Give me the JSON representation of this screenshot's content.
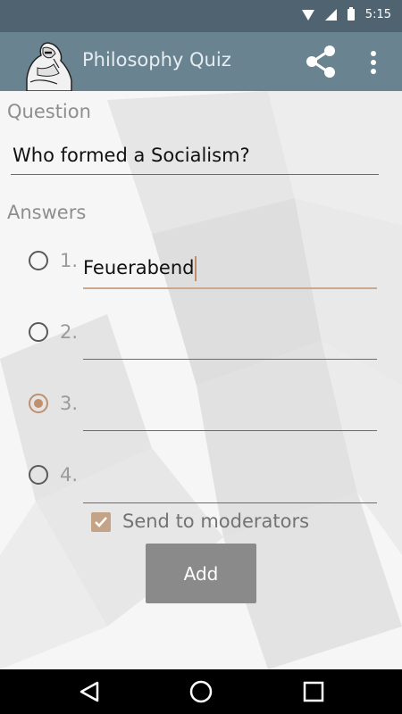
{
  "status_bar": {
    "time": "5:15",
    "icons": [
      "wifi-icon",
      "signal-icon",
      "battery-icon"
    ]
  },
  "app_bar": {
    "title": "Philosophy Quiz",
    "logo": "thinker-statue-logo",
    "actions": [
      "share-icon",
      "overflow-menu-icon"
    ]
  },
  "form": {
    "question_label": "Question",
    "question_value": "Who formed a Socialism?",
    "answers_label": "Answers",
    "answers": [
      {
        "number": "1.",
        "value": "Feuerabend",
        "selected": false,
        "focused": true
      },
      {
        "number": "2.",
        "value": "",
        "selected": false,
        "focused": false
      },
      {
        "number": "3.",
        "value": "",
        "selected": true,
        "focused": false
      },
      {
        "number": "4.",
        "value": "",
        "selected": false,
        "focused": false
      }
    ],
    "send_to_moderators_label": "Send to moderators",
    "send_to_moderators_checked": true,
    "add_button_label": "Add"
  },
  "nav_bar": {
    "buttons": [
      "back-icon",
      "home-icon",
      "recents-icon"
    ]
  },
  "colors": {
    "status_bar": "#4f6470",
    "app_bar": "#6a8391",
    "accent": "#c08f6e",
    "button": "#8a8a8a"
  }
}
